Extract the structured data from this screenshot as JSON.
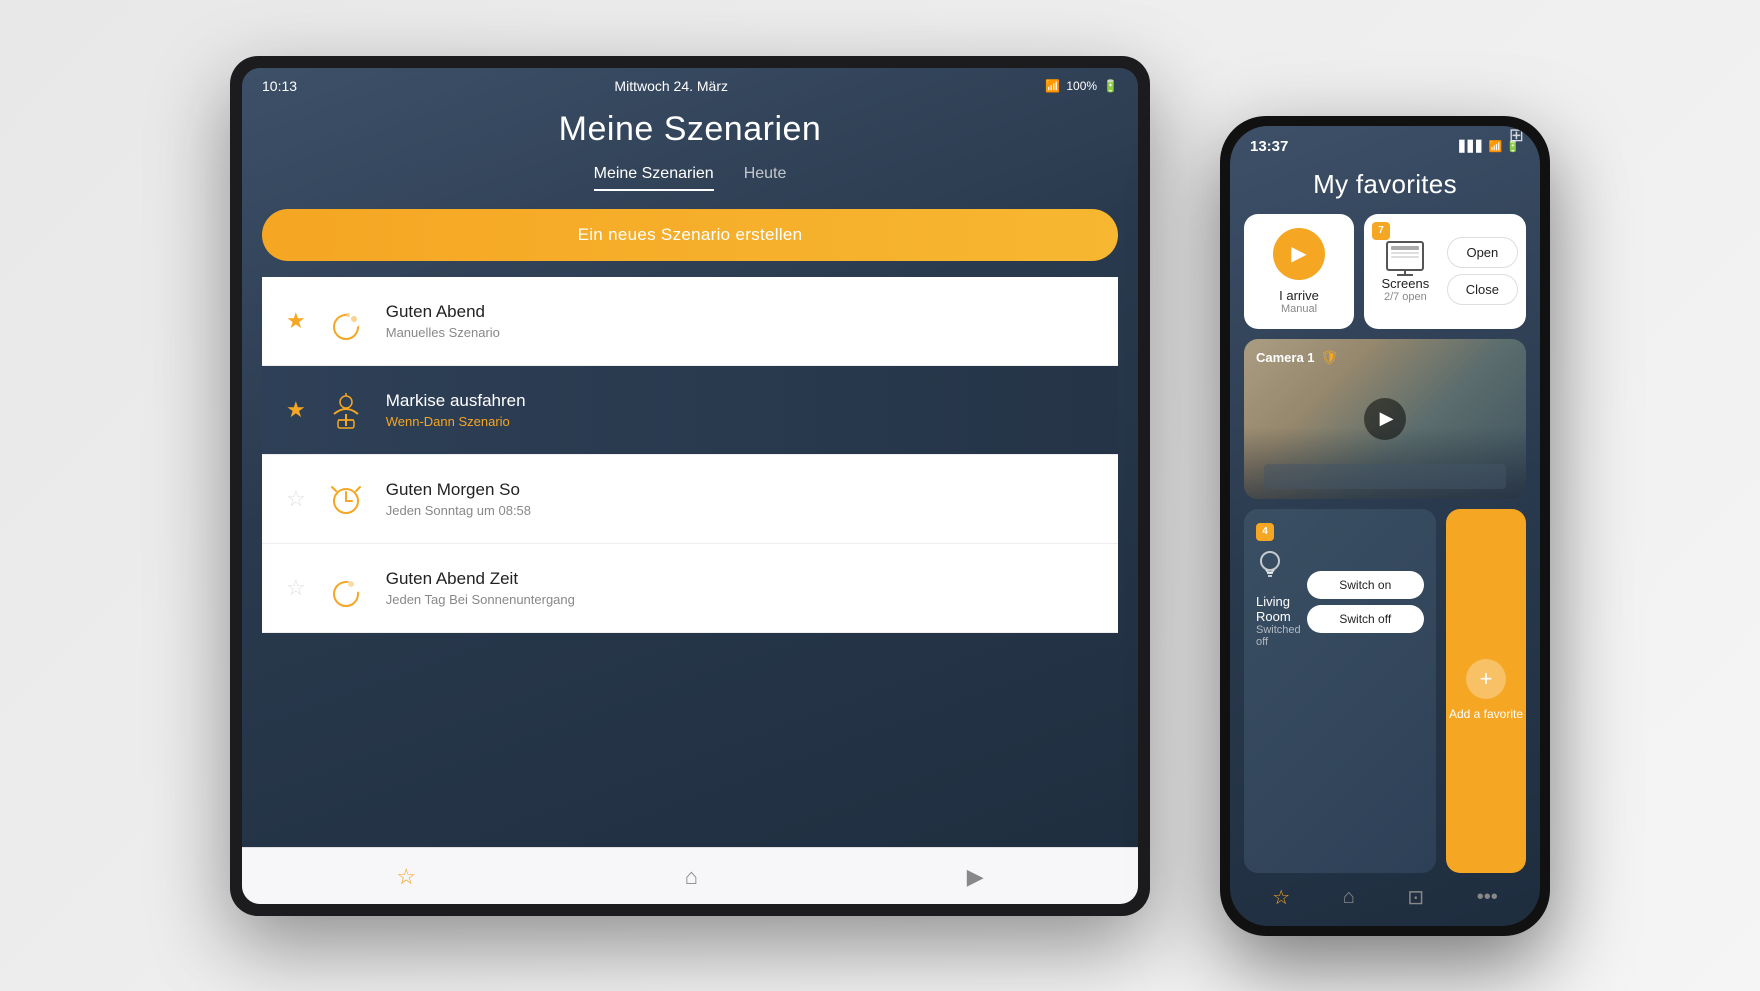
{
  "tablet": {
    "status_bar": {
      "time": "10:13",
      "date": "Mittwoch 24. März",
      "wifi": "📶",
      "battery": "100%"
    },
    "title": "Meine Szenarien",
    "tabs": [
      {
        "label": "Meine Szenarien",
        "active": true
      },
      {
        "label": "Heute",
        "active": false
      }
    ],
    "create_btn": "Ein neues Szenario erstellen",
    "scenarios": [
      {
        "name": "Guten Abend",
        "sub": "Manuelles Szenario",
        "star": "filled",
        "dark": false,
        "icon": "🌙"
      },
      {
        "name": "Markise ausfahren",
        "sub": "Wenn-Dann Szenario",
        "star": "filled",
        "dark": true,
        "icon": "⛱"
      },
      {
        "name": "Guten Morgen So",
        "sub": "Jeden Sonntag um 08:58",
        "star": "empty",
        "dark": false,
        "icon": "⏰"
      },
      {
        "name": "Guten Abend Zeit",
        "sub": "Jeden Tag Bei Sonnenuntergang",
        "star": "empty",
        "dark": false,
        "icon": "🌙"
      }
    ],
    "bottom_nav": [
      {
        "icon": "☆",
        "label": "favorites",
        "active": false
      },
      {
        "icon": "⌂",
        "label": "home",
        "active": false
      },
      {
        "icon": "▶",
        "label": "scenarios",
        "active": false
      }
    ]
  },
  "phone": {
    "status_bar": {
      "time": "13:37",
      "signal": "▋▋▋",
      "wifi": "📶",
      "battery": "🔋"
    },
    "title": "My favorites",
    "arrive_card": {
      "label": "I arrive",
      "sub": "Manual"
    },
    "screens_card": {
      "badge": "7",
      "label": "Screens",
      "sub": "2/7 open",
      "btn_open": "Open",
      "btn_close": "Close"
    },
    "camera": {
      "label": "Camera 1"
    },
    "living_room": {
      "badge": "4",
      "label": "Living Room",
      "sub": "Switched off",
      "btn_on": "Switch on",
      "btn_off": "Switch off"
    },
    "add_favorite": {
      "label": "Add a favorite"
    },
    "bottom_nav": [
      {
        "icon": "☆",
        "label": "favorites",
        "active": true
      },
      {
        "icon": "⌂",
        "label": "home",
        "active": false
      },
      {
        "icon": "⧉",
        "label": "grid",
        "active": false
      },
      {
        "icon": "•••",
        "label": "more",
        "active": false
      }
    ]
  }
}
